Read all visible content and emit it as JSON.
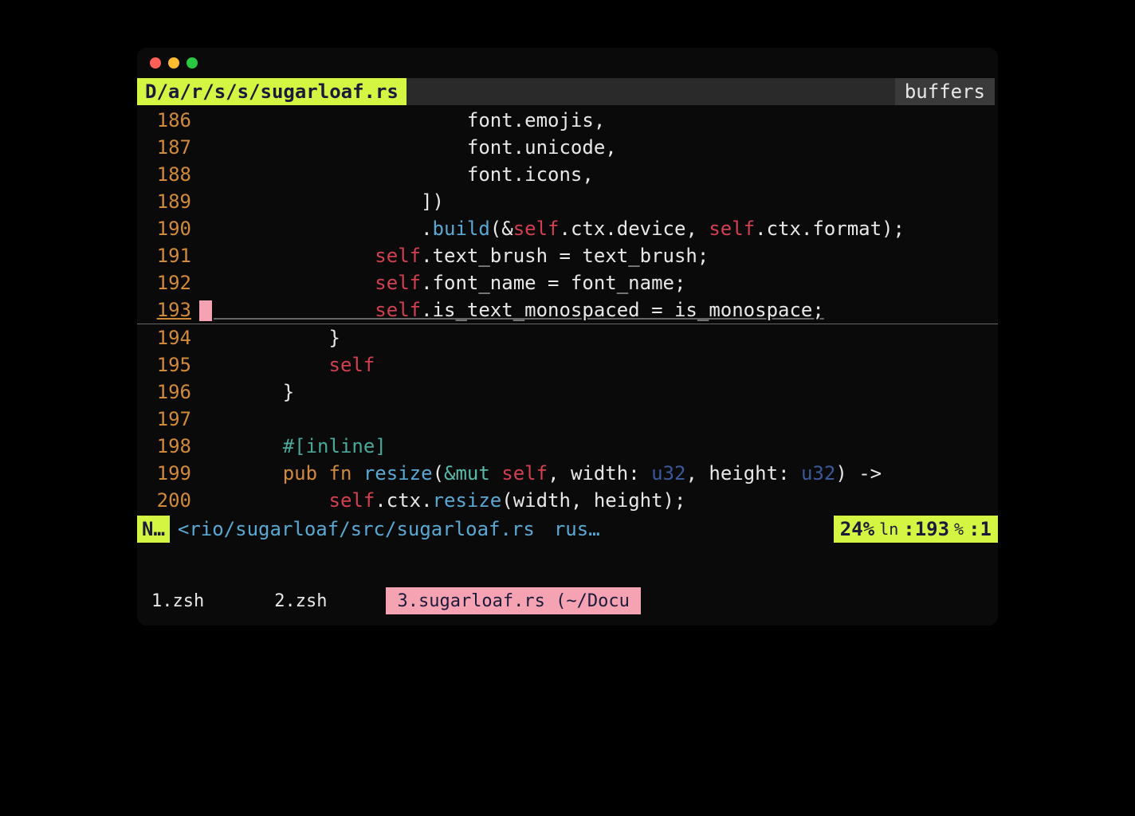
{
  "header": {
    "path_tab": "D/a/r/s/s/sugarloaf.rs",
    "buffers_label": "buffers"
  },
  "code": {
    "lines": [
      {
        "num": "186",
        "current": false,
        "tokens": [
          {
            "t": "                      font.emojis,",
            "c": "tok-plain"
          }
        ]
      },
      {
        "num": "187",
        "current": false,
        "tokens": [
          {
            "t": "                      font.unicode,",
            "c": "tok-plain"
          }
        ]
      },
      {
        "num": "188",
        "current": false,
        "tokens": [
          {
            "t": "                      font.icons,",
            "c": "tok-plain"
          }
        ]
      },
      {
        "num": "189",
        "current": false,
        "tokens": [
          {
            "t": "                  ])",
            "c": "tok-plain"
          }
        ]
      },
      {
        "num": "190",
        "current": false,
        "tokens": [
          {
            "t": "                  .",
            "c": "tok-plain"
          },
          {
            "t": "build",
            "c": "tok-blue"
          },
          {
            "t": "(&",
            "c": "tok-plain"
          },
          {
            "t": "self",
            "c": "tok-red"
          },
          {
            "t": ".ctx.device, ",
            "c": "tok-plain"
          },
          {
            "t": "self",
            "c": "tok-red"
          },
          {
            "t": ".ctx.format);",
            "c": "tok-plain"
          }
        ]
      },
      {
        "num": "191",
        "current": false,
        "tokens": [
          {
            "t": "              ",
            "c": "tok-plain"
          },
          {
            "t": "self",
            "c": "tok-red"
          },
          {
            "t": ".text_brush = text_brush;",
            "c": "tok-plain"
          }
        ]
      },
      {
        "num": "192",
        "current": false,
        "tokens": [
          {
            "t": "              ",
            "c": "tok-plain"
          },
          {
            "t": "self",
            "c": "tok-red"
          },
          {
            "t": ".font_name = font_name;",
            "c": "tok-plain"
          }
        ]
      },
      {
        "num": "193",
        "current": true,
        "tokens": [
          {
            "t": "              ",
            "c": "tok-plain"
          },
          {
            "t": "self",
            "c": "tok-red"
          },
          {
            "t": ".is_text_monospaced = is_monospace;",
            "c": "tok-plain"
          }
        ]
      },
      {
        "num": "194",
        "current": false,
        "tokens": [
          {
            "t": "          }",
            "c": "tok-plain"
          }
        ]
      },
      {
        "num": "195",
        "current": false,
        "tokens": [
          {
            "t": "          ",
            "c": "tok-plain"
          },
          {
            "t": "self",
            "c": "tok-red"
          }
        ]
      },
      {
        "num": "196",
        "current": false,
        "tokens": [
          {
            "t": "      }",
            "c": "tok-plain"
          }
        ]
      },
      {
        "num": "197",
        "current": false,
        "tokens": [
          {
            "t": "",
            "c": "tok-plain"
          }
        ]
      },
      {
        "num": "198",
        "current": false,
        "tokens": [
          {
            "t": "      ",
            "c": "tok-plain"
          },
          {
            "t": "#[inline]",
            "c": "tok-teal"
          }
        ]
      },
      {
        "num": "199",
        "current": false,
        "tokens": [
          {
            "t": "      ",
            "c": "tok-plain"
          },
          {
            "t": "pub fn",
            "c": "tok-orange"
          },
          {
            "t": " ",
            "c": "tok-plain"
          },
          {
            "t": "resize",
            "c": "tok-blue"
          },
          {
            "t": "(",
            "c": "tok-plain"
          },
          {
            "t": "&mut",
            "c": "tok-teal2"
          },
          {
            "t": " ",
            "c": "tok-plain"
          },
          {
            "t": "self",
            "c": "tok-red"
          },
          {
            "t": ", width: ",
            "c": "tok-plain"
          },
          {
            "t": "u32",
            "c": "tok-navy"
          },
          {
            "t": ", height: ",
            "c": "tok-plain"
          },
          {
            "t": "u32",
            "c": "tok-navy"
          },
          {
            "t": ") ->",
            "c": "tok-plain"
          }
        ]
      },
      {
        "num": "200",
        "current": false,
        "tokens": [
          {
            "t": "          ",
            "c": "tok-plain"
          },
          {
            "t": "self",
            "c": "tok-red"
          },
          {
            "t": ".ctx.",
            "c": "tok-plain"
          },
          {
            "t": "resize",
            "c": "tok-blue"
          },
          {
            "t": "(width, height);",
            "c": "tok-plain"
          }
        ]
      }
    ]
  },
  "status": {
    "mode": "N…",
    "path": "<rio/sugarloaf/src/sugarloaf.rs",
    "lang": "rus…",
    "percent": "24%",
    "ln_label": "ln",
    "ln_value": ":193",
    "col_label": "%",
    "col_value": ":1"
  },
  "tabs": {
    "items": [
      {
        "label": "1.zsh",
        "active": false
      },
      {
        "label": "2.zsh",
        "active": false
      },
      {
        "label": "3.sugarloaf.rs (~/Docu",
        "active": true
      }
    ]
  }
}
